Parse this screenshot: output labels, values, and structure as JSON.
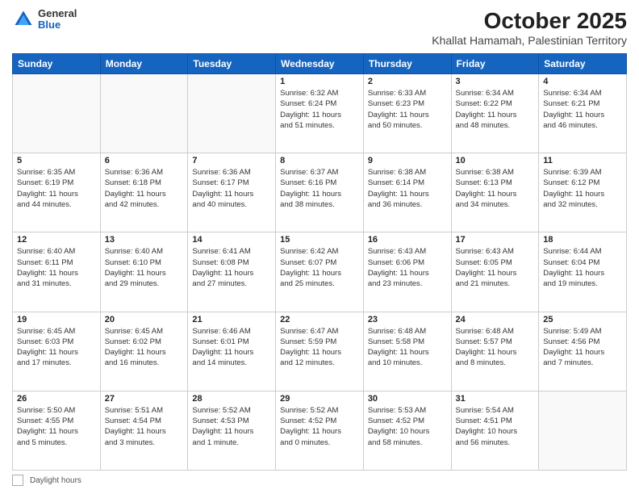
{
  "header": {
    "logo_general": "General",
    "logo_blue": "Blue",
    "title": "October 2025",
    "subtitle": "Khallat Hamamah, Palestinian Territory"
  },
  "days_of_week": [
    "Sunday",
    "Monday",
    "Tuesday",
    "Wednesday",
    "Thursday",
    "Friday",
    "Saturday"
  ],
  "weeks": [
    [
      {
        "day": "",
        "info": ""
      },
      {
        "day": "",
        "info": ""
      },
      {
        "day": "",
        "info": ""
      },
      {
        "day": "1",
        "info": "Sunrise: 6:32 AM\nSunset: 6:24 PM\nDaylight: 11 hours\nand 51 minutes."
      },
      {
        "day": "2",
        "info": "Sunrise: 6:33 AM\nSunset: 6:23 PM\nDaylight: 11 hours\nand 50 minutes."
      },
      {
        "day": "3",
        "info": "Sunrise: 6:34 AM\nSunset: 6:22 PM\nDaylight: 11 hours\nand 48 minutes."
      },
      {
        "day": "4",
        "info": "Sunrise: 6:34 AM\nSunset: 6:21 PM\nDaylight: 11 hours\nand 46 minutes."
      }
    ],
    [
      {
        "day": "5",
        "info": "Sunrise: 6:35 AM\nSunset: 6:19 PM\nDaylight: 11 hours\nand 44 minutes."
      },
      {
        "day": "6",
        "info": "Sunrise: 6:36 AM\nSunset: 6:18 PM\nDaylight: 11 hours\nand 42 minutes."
      },
      {
        "day": "7",
        "info": "Sunrise: 6:36 AM\nSunset: 6:17 PM\nDaylight: 11 hours\nand 40 minutes."
      },
      {
        "day": "8",
        "info": "Sunrise: 6:37 AM\nSunset: 6:16 PM\nDaylight: 11 hours\nand 38 minutes."
      },
      {
        "day": "9",
        "info": "Sunrise: 6:38 AM\nSunset: 6:14 PM\nDaylight: 11 hours\nand 36 minutes."
      },
      {
        "day": "10",
        "info": "Sunrise: 6:38 AM\nSunset: 6:13 PM\nDaylight: 11 hours\nand 34 minutes."
      },
      {
        "day": "11",
        "info": "Sunrise: 6:39 AM\nSunset: 6:12 PM\nDaylight: 11 hours\nand 32 minutes."
      }
    ],
    [
      {
        "day": "12",
        "info": "Sunrise: 6:40 AM\nSunset: 6:11 PM\nDaylight: 11 hours\nand 31 minutes."
      },
      {
        "day": "13",
        "info": "Sunrise: 6:40 AM\nSunset: 6:10 PM\nDaylight: 11 hours\nand 29 minutes."
      },
      {
        "day": "14",
        "info": "Sunrise: 6:41 AM\nSunset: 6:08 PM\nDaylight: 11 hours\nand 27 minutes."
      },
      {
        "day": "15",
        "info": "Sunrise: 6:42 AM\nSunset: 6:07 PM\nDaylight: 11 hours\nand 25 minutes."
      },
      {
        "day": "16",
        "info": "Sunrise: 6:43 AM\nSunset: 6:06 PM\nDaylight: 11 hours\nand 23 minutes."
      },
      {
        "day": "17",
        "info": "Sunrise: 6:43 AM\nSunset: 6:05 PM\nDaylight: 11 hours\nand 21 minutes."
      },
      {
        "day": "18",
        "info": "Sunrise: 6:44 AM\nSunset: 6:04 PM\nDaylight: 11 hours\nand 19 minutes."
      }
    ],
    [
      {
        "day": "19",
        "info": "Sunrise: 6:45 AM\nSunset: 6:03 PM\nDaylight: 11 hours\nand 17 minutes."
      },
      {
        "day": "20",
        "info": "Sunrise: 6:45 AM\nSunset: 6:02 PM\nDaylight: 11 hours\nand 16 minutes."
      },
      {
        "day": "21",
        "info": "Sunrise: 6:46 AM\nSunset: 6:01 PM\nDaylight: 11 hours\nand 14 minutes."
      },
      {
        "day": "22",
        "info": "Sunrise: 6:47 AM\nSunset: 5:59 PM\nDaylight: 11 hours\nand 12 minutes."
      },
      {
        "day": "23",
        "info": "Sunrise: 6:48 AM\nSunset: 5:58 PM\nDaylight: 11 hours\nand 10 minutes."
      },
      {
        "day": "24",
        "info": "Sunrise: 6:48 AM\nSunset: 5:57 PM\nDaylight: 11 hours\nand 8 minutes."
      },
      {
        "day": "25",
        "info": "Sunrise: 5:49 AM\nSunset: 4:56 PM\nDaylight: 11 hours\nand 7 minutes."
      }
    ],
    [
      {
        "day": "26",
        "info": "Sunrise: 5:50 AM\nSunset: 4:55 PM\nDaylight: 11 hours\nand 5 minutes."
      },
      {
        "day": "27",
        "info": "Sunrise: 5:51 AM\nSunset: 4:54 PM\nDaylight: 11 hours\nand 3 minutes."
      },
      {
        "day": "28",
        "info": "Sunrise: 5:52 AM\nSunset: 4:53 PM\nDaylight: 11 hours\nand 1 minute."
      },
      {
        "day": "29",
        "info": "Sunrise: 5:52 AM\nSunset: 4:52 PM\nDaylight: 11 hours\nand 0 minutes."
      },
      {
        "day": "30",
        "info": "Sunrise: 5:53 AM\nSunset: 4:52 PM\nDaylight: 10 hours\nand 58 minutes."
      },
      {
        "day": "31",
        "info": "Sunrise: 5:54 AM\nSunset: 4:51 PM\nDaylight: 10 hours\nand 56 minutes."
      },
      {
        "day": "",
        "info": ""
      }
    ]
  ],
  "footer": {
    "daylight_label": "Daylight hours"
  }
}
